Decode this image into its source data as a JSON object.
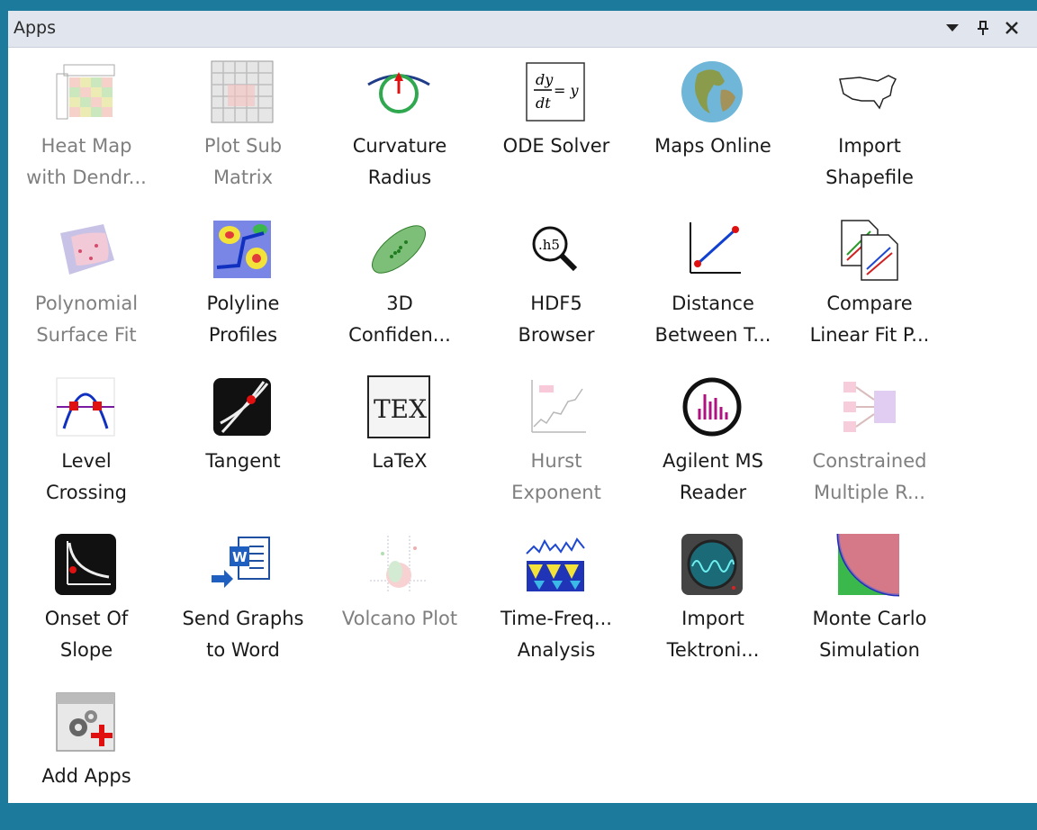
{
  "panel": {
    "title": "Apps",
    "controls": {
      "dropdown": "▼",
      "pin": "ᵖ",
      "close": "✕"
    }
  },
  "apps": [
    {
      "line1": "Heat Map",
      "line2": "with Dendr...",
      "icon": "heatmap-icon",
      "dim": true
    },
    {
      "line1": "Plot Sub",
      "line2": "Matrix",
      "icon": "plot-sub-matrix-icon",
      "dim": true
    },
    {
      "line1": "Curvature",
      "line2": "Radius",
      "icon": "curvature-icon",
      "dim": false
    },
    {
      "line1": "ODE Solver",
      "line2": "",
      "icon": "ode-icon",
      "dim": false
    },
    {
      "line1": "Maps Online",
      "line2": "",
      "icon": "globe-icon",
      "dim": false
    },
    {
      "line1": "Import",
      "line2": "Shapefile",
      "icon": "usa-map-icon",
      "dim": false
    },
    {
      "line1": "Polynomial",
      "line2": "Surface Fit",
      "icon": "surface-fit-icon",
      "dim": true
    },
    {
      "line1": "Polyline",
      "line2": "Profiles",
      "icon": "polyline-icon",
      "dim": false
    },
    {
      "line1": "3D",
      "line2": "Confiden...",
      "icon": "ellipsoid-icon",
      "dim": false
    },
    {
      "line1": "HDF5",
      "line2": "Browser",
      "icon": "hdf5-icon",
      "dim": false
    },
    {
      "line1": "Distance",
      "line2": "Between T...",
      "icon": "distance-icon",
      "dim": false
    },
    {
      "line1": "Compare",
      "line2": "Linear Fit P...",
      "icon": "compare-fit-icon",
      "dim": false
    },
    {
      "line1": "Level",
      "line2": "Crossing",
      "icon": "level-crossing-icon",
      "dim": false
    },
    {
      "line1": "Tangent",
      "line2": "",
      "icon": "tangent-icon",
      "dim": false
    },
    {
      "line1": "LaTeX",
      "line2": "",
      "icon": "latex-icon",
      "dim": false
    },
    {
      "line1": "Hurst",
      "line2": "Exponent",
      "icon": "hurst-icon",
      "dim": true
    },
    {
      "line1": "Agilent MS",
      "line2": "Reader",
      "icon": "agilent-icon",
      "dim": false
    },
    {
      "line1": "Constrained",
      "line2": "Multiple R...",
      "icon": "constrained-icon",
      "dim": true
    },
    {
      "line1": "Onset Of",
      "line2": "Slope",
      "icon": "onset-icon",
      "dim": false
    },
    {
      "line1": "Send Graphs",
      "line2": "to Word",
      "icon": "word-icon",
      "dim": false
    },
    {
      "line1": "Volcano Plot",
      "line2": "",
      "icon": "volcano-icon",
      "dim": true
    },
    {
      "line1": "Time-Freq...",
      "line2": "Analysis",
      "icon": "time-freq-icon",
      "dim": false
    },
    {
      "line1": "Import",
      "line2": "Tektroni...",
      "icon": "oscilloscope-icon",
      "dim": false
    },
    {
      "line1": "Monte Carlo",
      "line2": "Simulation",
      "icon": "monte-carlo-icon",
      "dim": false
    },
    {
      "line1": "Add Apps",
      "line2": "",
      "icon": "add-apps-icon",
      "dim": false
    }
  ],
  "icon_text": {
    "ode": {
      "dy": "dy",
      "dt": "dt",
      "eq": "= y"
    },
    "hdf5": ".h5",
    "latex": "TEX"
  },
  "colors": {
    "background": "#1c7b9d",
    "titlebar": "#e0e5ee",
    "label": "#1a1a1a",
    "label_dim": "#7f7f7f"
  }
}
